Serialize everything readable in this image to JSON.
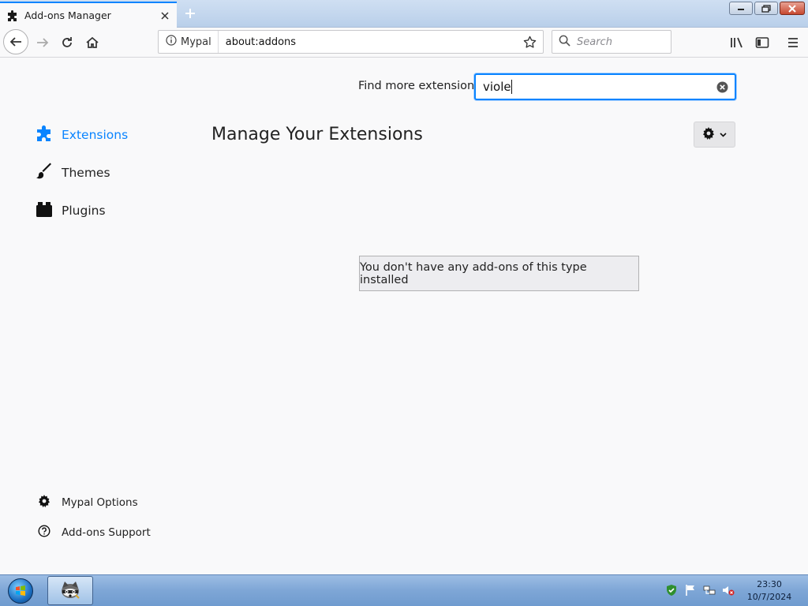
{
  "tab": {
    "title": "Add-ons Manager",
    "active": true
  },
  "window_controls": {
    "minimize": "minimize",
    "restore": "restore",
    "close": "close"
  },
  "navbar": {
    "identity_label": "Mypal",
    "url": "about:addons",
    "search_placeholder": "Search"
  },
  "find_more": {
    "label": "Find more extensions",
    "value": "viole"
  },
  "sidebar": {
    "categories": [
      {
        "label": "Extensions",
        "icon": "puzzle-icon",
        "selected": true
      },
      {
        "label": "Themes",
        "icon": "brush-icon",
        "selected": false
      },
      {
        "label": "Plugins",
        "icon": "plugin-icon",
        "selected": false
      }
    ],
    "footer_links": [
      {
        "label": "Mypal Options",
        "icon": "gear-icon"
      },
      {
        "label": "Add-ons Support",
        "icon": "help-icon"
      }
    ]
  },
  "main": {
    "heading": "Manage Your Extensions",
    "empty_notice": "You don't have any add-ons of this type installed"
  },
  "taskbar": {
    "clock_time": "23:30",
    "clock_date": "10/7/2024",
    "pinned_app": "mypal-raccoon-icon"
  },
  "colors": {
    "accent": "#0a84ff",
    "page_bg": "#f9f9fa",
    "taskbar": "#7ea6d6"
  }
}
